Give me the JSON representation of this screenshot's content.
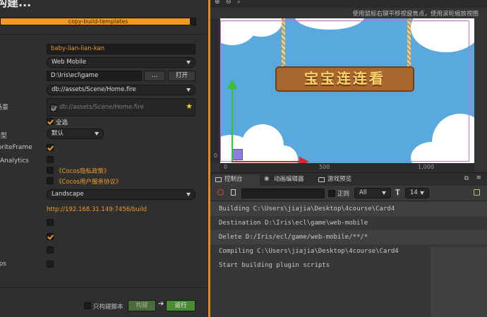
{
  "window": {
    "title": "构建..."
  },
  "progress": {
    "label": "copy-build-templates",
    "value": 0.97
  },
  "form": {
    "game_name": {
      "value": "baby-lian-lian-kan"
    },
    "platform": {
      "value": "Web Mobile"
    },
    "build_path": {
      "value": "D:\\Iris\\ecl\\game",
      "browse_label": "...",
      "open_label": "打开"
    },
    "start_scene": {
      "value": "db://assets/Scene/Home.fire"
    },
    "scenes_label": "场景",
    "scenes_list_item": "db://assets/Scene/Home.fire",
    "select_all": {
      "label": "全选",
      "checked": true
    },
    "merge_label": "类型",
    "merge_value": "默认",
    "sprite_frame_label": "...priteFrame",
    "sprite_frame_checked": true,
    "analytics_label": "Analytics",
    "analytics_checked": false,
    "privacy": {
      "label": "《Cocos隐私政策》",
      "checked": false
    },
    "service": {
      "label": "《Cocos用户服务协议》",
      "checked": false
    },
    "orientation": {
      "value": "Landscape"
    },
    "preview_url": "http://192.168.31.149:7456/build",
    "opt1_checked": false,
    "opt2_checked": true,
    "opt3_checked": false,
    "opt4_label": "...ps",
    "opt4_checked": false
  },
  "footer": {
    "only_script": {
      "label": "只构建脚本",
      "checked": false
    },
    "build_label": "构建",
    "run_label": "运行"
  },
  "scene": {
    "hint": "使用鼠标右键平移视窗焦点，使用滚轮缩放视图",
    "game_title": "宝宝连连看",
    "ruler_x": [
      "0",
      "500",
      "1,000"
    ],
    "ruler_y": [
      "0"
    ]
  },
  "console": {
    "tabs": [
      {
        "label": "控制台"
      },
      {
        "label": "动画编辑器"
      },
      {
        "label": "游戏预览"
      }
    ],
    "regex_label": "正则",
    "level_value": "All",
    "font_size_value": "14",
    "logs": [
      "Building C:\\Users\\jiajia\\Desktop\\4course\\Card4",
      "Destination D:\\Iris\\ecl\\game\\web-mobile",
      "Delete D:/Iris/ecl/game/web-mobile/**/*",
      "Compiling C:\\Users\\jiajia\\Desktop\\4course\\Card4",
      "Start building plugin scripts"
    ]
  },
  "colors": {
    "accent": "#f39a1e",
    "run_button": "#4a8c33",
    "build_button": "#4a6b3a"
  }
}
